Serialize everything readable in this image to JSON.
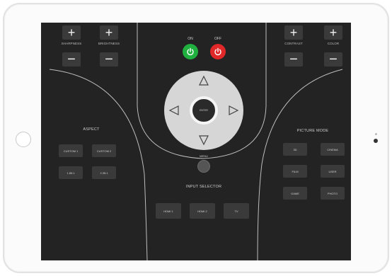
{
  "remote": {
    "left_controls": [
      {
        "label": "SHARPNESS",
        "plus": "+",
        "minus": "−"
      },
      {
        "label": "BRIGHTNESS",
        "plus": "+",
        "minus": "−"
      }
    ],
    "right_controls": [
      {
        "label": "CONTRAST",
        "plus": "+",
        "minus": "−"
      },
      {
        "label": "COLOR",
        "plus": "+",
        "minus": "−"
      }
    ],
    "power": {
      "on_label": "ON",
      "off_label": "OFF",
      "on_color": "#20b040",
      "off_color": "#e02828"
    },
    "dpad": {
      "enter_label": "ENTER",
      "up_icon": "triangle-up",
      "down_icon": "triangle-down",
      "left_icon": "triangle-left",
      "right_icon": "triangle-right"
    },
    "menu_label": "MENU",
    "aspect": {
      "title": "ASPECT",
      "buttons": [
        "CUSTOM 1",
        "CUSTOM 2",
        "1.85:1",
        "2.35:1"
      ]
    },
    "picture_mode": {
      "title": "PICTURE MODE",
      "buttons": [
        "3D",
        "CINEMA",
        "FILM",
        "USER",
        "GAME",
        "PHOTO"
      ]
    },
    "input_selector": {
      "title": "INPUT SELECTOR",
      "buttons": [
        "HDMI 1",
        "HDMI 2",
        "TV"
      ]
    }
  }
}
